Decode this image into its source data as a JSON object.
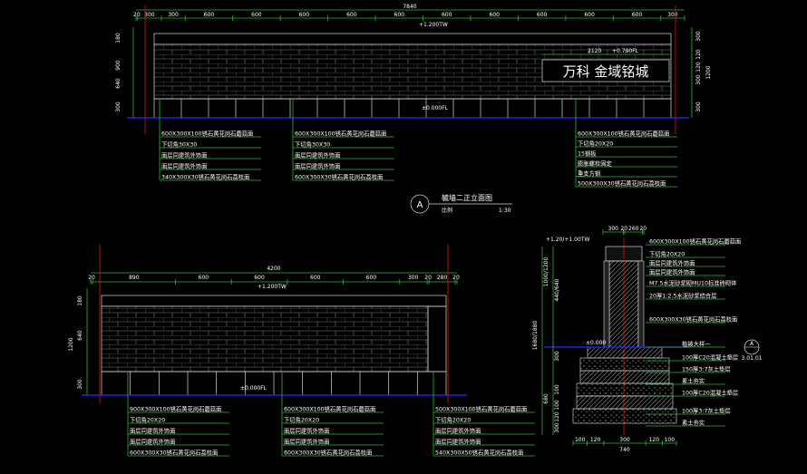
{
  "colors": {
    "background": "#000000",
    "dim": "#2fb52f",
    "line": "#d8d8d8",
    "axis": "#d21b1b",
    "ground": "#2a2aff",
    "hatch": "#8a8a8a"
  },
  "top_elevation": {
    "overall_dim": "7840",
    "segments": [
      "20",
      "300",
      "300",
      "600",
      "600",
      "600",
      "600",
      "600",
      "600",
      "600",
      "600",
      "600",
      "600",
      "300"
    ],
    "left_dims": [
      "900",
      "640",
      "180",
      "300"
    ],
    "right_dims": [
      "300",
      "120",
      "120",
      "300",
      "300",
      "1200"
    ],
    "sign_dim": "2120",
    "sign_level": "+0.790FL",
    "top_level": "+1.200TW",
    "ground_level": "±0.000FL",
    "sign_text": "万科 金域铭城",
    "notes_left": [
      "600X300X100锈石黄花岗石蘑菇面",
      "下切角30X30",
      "面层同建筑外饰面",
      "面层同建筑外饰面",
      "340X300X30锈石黄花岗石荔枝面"
    ],
    "notes_mid": [
      "600X300X100锈石黄花岗石蘑菇面",
      "下切角30X30",
      "面层同建筑外饰面",
      "面层同建筑外饰面",
      "600X300X30锈石黄花岗石荔枝面"
    ],
    "notes_right": [
      "600X300X100锈石黄花岗石蘑菇面",
      "下切角20X20",
      "15钢板",
      "膨胀螺栓固定",
      "重支方钢",
      "500X300X30锈石黄花岗石荔枝面"
    ]
  },
  "title_block": {
    "letter": "A",
    "title": "毓墙二正立面图",
    "sub": "比例",
    "scale": "1:30"
  },
  "bottom_elevation": {
    "overall_dim": "4200",
    "segments": [
      "20",
      "890",
      "600",
      "600",
      "600",
      "600",
      "300",
      "20",
      "280",
      "20"
    ],
    "left_dims": [
      "1200",
      "640",
      "180",
      "300"
    ],
    "top_level": "+1.200TW",
    "ground_level": "±0.000FL",
    "notes_left": [
      "900X300X100锈石黄花岗石蘑菇面",
      "下切角20X20",
      "面层同建筑外饰面",
      "面层同建筑外饰面",
      "600X300X30锈石黄花岗石荔枝面"
    ],
    "notes_mid": [
      "600X300X100锈石黄花岗石蘑菇面",
      "下切角20X20",
      "面层同建筑外饰面",
      "面层同建筑外饰面",
      "600X300X30锈石黄花岗石荔枝面"
    ],
    "notes_right": [
      "500X300X100锈石黄花岗石蘑菇面",
      "下切角20X20",
      "面层同建筑外饰面",
      "面层同建筑外饰面",
      "540X300X50锈石黄花岗石荔枝面"
    ]
  },
  "section": {
    "top_dims": [
      "300",
      "20",
      "260",
      "20"
    ],
    "top_level": "+1.20/+1.00TW",
    "ground_level": "±0.000",
    "left_dims": [
      "1680/1880",
      "1000/1200",
      "440/640",
      "300",
      "680",
      "100",
      "100",
      "120",
      "300"
    ],
    "bottom_dims": [
      "100",
      "120",
      "300",
      "120",
      "100",
      "740"
    ],
    "callout_letter": "A",
    "callout_ref": "3.01.01",
    "notes": [
      "600X300X100锈石黄花岗石蘑菇面",
      "下切角20X20",
      "面层同建筑外饰面",
      "面层同建筑外饰面",
      "M7.5水泥砂浆砌MU10标准砖砌体",
      "20厚1:2.5水泥砂浆结合层",
      "600X300X30锈石黄花岗石荔枝面",
      "植被大样一",
      "100厚C20混凝土垫层",
      "150厚3:7灰土垫层",
      "素土夯实",
      "100厚C20混凝土垫层",
      "100厚3:7灰土垫层",
      "素土夯实"
    ]
  }
}
